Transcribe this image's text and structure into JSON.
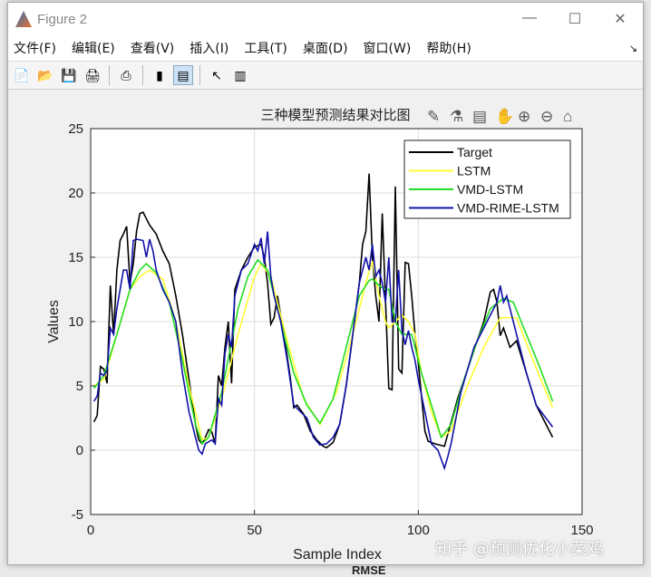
{
  "window": {
    "title": "Figure 2",
    "minimize": "—",
    "maximize": "☐",
    "close": "✕"
  },
  "menu": [
    "文件(F)",
    "编辑(E)",
    "查看(V)",
    "插入(I)",
    "工具(T)",
    "桌面(D)",
    "窗口(W)",
    "帮助(H)"
  ],
  "menu_arrow": "↘",
  "toolbar": [
    "📄",
    "📂",
    "💾",
    "🖨",
    "⎙",
    "▮",
    "▤",
    "↖",
    "▥"
  ],
  "axes_toolbar": [
    "✎",
    "⚗",
    "▤",
    "✋",
    "⊕",
    "⊖",
    "⌂"
  ],
  "watermark": "知乎 @预测优化小菜鸡",
  "background_text": "RMSE",
  "chart_data": {
    "type": "line",
    "title": "三种模型预测结果对比图",
    "xlabel": "Sample Index",
    "ylabel": "Values",
    "xlim": [
      0,
      150
    ],
    "ylim": [
      -5,
      25
    ],
    "xticks": [
      0,
      50,
      100,
      150
    ],
    "yticks": [
      -5,
      0,
      5,
      10,
      15,
      20,
      25
    ],
    "grid": true,
    "legend_position": "top-right",
    "series": [
      {
        "name": "Target",
        "color": "#000000",
        "x": [
          1,
          2,
          3,
          4,
          5,
          6,
          7,
          8,
          9,
          10,
          11,
          12,
          13,
          14,
          15,
          16,
          18,
          20,
          22,
          24,
          26,
          28,
          30,
          32,
          33,
          34,
          35,
          36,
          37,
          38,
          39,
          40,
          41,
          42,
          43,
          44,
          46,
          48,
          50,
          52,
          53,
          54,
          55,
          56,
          57,
          59,
          61,
          62,
          63,
          65,
          67,
          69,
          71,
          72,
          74,
          76,
          78,
          80,
          82,
          83,
          84,
          85,
          86,
          87,
          88,
          89,
          91,
          92,
          93,
          94,
          95,
          96,
          97,
          98,
          99,
          100,
          102,
          103,
          105,
          108,
          112,
          116,
          120,
          122,
          123,
          124,
          125,
          126,
          128,
          130,
          133,
          136,
          141
        ],
        "y": [
          2.2,
          2.7,
          6.5,
          6.3,
          5.2,
          12.8,
          9,
          14,
          16.3,
          16.8,
          17.4,
          13,
          14.5,
          17,
          18.4,
          18.5,
          17.5,
          16.8,
          15.5,
          14.5,
          12,
          9,
          5.5,
          2,
          0.8,
          0.5,
          1,
          1.6,
          1.4,
          0.5,
          5.8,
          5,
          8,
          10,
          5.2,
          12.5,
          14,
          15,
          15.8,
          16,
          15,
          13,
          9.8,
          10.3,
          12,
          9,
          5.5,
          3.3,
          3.5,
          2.8,
          1.5,
          0.8,
          0.3,
          0.2,
          0.6,
          2,
          5,
          9,
          13,
          16,
          17,
          21.5,
          15,
          12,
          10,
          18.4,
          4.8,
          4.7,
          20.5,
          6.3,
          6,
          14.6,
          14.5,
          12,
          9,
          6.8,
          1.5,
          0.7,
          0.5,
          0.3,
          4,
          7,
          10,
          12.3,
          12.5,
          11.5,
          8.9,
          9.5,
          8,
          8.5,
          6,
          3.5,
          1
        ]
      },
      {
        "name": "LSTM",
        "color": "#ffff33",
        "x": [
          1,
          4,
          8,
          12,
          15,
          18,
          22,
          26,
          30,
          34,
          36,
          40,
          45,
          50,
          52,
          55,
          60,
          65,
          70,
          75,
          80,
          84,
          86,
          88,
          90,
          91,
          93,
          95,
          97,
          99,
          101,
          104,
          107,
          110,
          115,
          120,
          125,
          130,
          135,
          141
        ],
        "y": [
          5,
          5.5,
          9,
          12.5,
          13.5,
          14,
          13.3,
          10,
          5,
          0.8,
          1,
          4,
          9,
          13.5,
          14.5,
          13.5,
          8.5,
          4,
          2,
          4.5,
          9,
          13,
          14.7,
          12,
          10,
          9.5,
          10,
          10.5,
          10,
          9,
          6,
          3,
          1,
          1.5,
          5,
          8,
          10.3,
          10.3,
          7,
          3.3
        ]
      },
      {
        "name": "VMD-LSTM",
        "color": "#22dd22",
        "x": [
          1,
          4,
          8,
          12,
          15,
          17,
          20,
          24,
          28,
          32,
          34,
          36,
          40,
          45,
          48,
          51,
          54,
          58,
          62,
          66,
          70,
          74,
          78,
          82,
          85,
          86,
          88,
          90,
          91,
          93,
          95,
          98,
          101,
          104,
          107,
          110,
          114,
          118,
          122,
          126,
          129,
          133,
          137,
          141
        ],
        "y": [
          4.8,
          5.8,
          9,
          12.5,
          14,
          14.5,
          13.8,
          11.5,
          7,
          2,
          0.5,
          1,
          4.5,
          11,
          13.5,
          14.8,
          14,
          10,
          6,
          3.5,
          2.1,
          4,
          8,
          12,
          13.2,
          13.3,
          12.8,
          12.5,
          12.5,
          10,
          9,
          9,
          6,
          3.5,
          1,
          2,
          5.5,
          8.5,
          11,
          11.8,
          11.5,
          9,
          6.5,
          3.8
        ]
      },
      {
        "name": "VMD-RIME-LSTM",
        "color": "#1111aa",
        "x": [
          1,
          2,
          3,
          4,
          5,
          6,
          7,
          8,
          9,
          10,
          11,
          12,
          13,
          14,
          16,
          17,
          18,
          19,
          20,
          22,
          24,
          26,
          28,
          30,
          32,
          33,
          34,
          35,
          37,
          38,
          39,
          40,
          41,
          42,
          43,
          44,
          46,
          48,
          50,
          51,
          52,
          53,
          54,
          55,
          56,
          58,
          60,
          62,
          64,
          66,
          68,
          70,
          72,
          74,
          76,
          78,
          80,
          82,
          84,
          85,
          86,
          87,
          88,
          89,
          90,
          91,
          92,
          93,
          94,
          95,
          96,
          97,
          98,
          99,
          100,
          102,
          104,
          106,
          108,
          109,
          110,
          113,
          117,
          121,
          124,
          125,
          126,
          127,
          128,
          130,
          133,
          136,
          141
        ],
        "y": [
          3.8,
          4.2,
          6,
          5.8,
          6.2,
          9.5,
          9,
          11,
          12.5,
          14,
          14,
          12.5,
          16.3,
          16.4,
          16.3,
          15,
          16.4,
          15.5,
          14,
          12.5,
          11.5,
          10,
          6,
          3,
          1,
          0,
          -0.3,
          0.5,
          0.8,
          0.5,
          4,
          3.5,
          7.5,
          9,
          8,
          12,
          14,
          14.5,
          16,
          15.5,
          16.5,
          14.5,
          17,
          13.5,
          12,
          10,
          7,
          3.5,
          3,
          2.5,
          1,
          0.4,
          0.5,
          1,
          2,
          5,
          9,
          13,
          15,
          14,
          16,
          13.5,
          14,
          13,
          11.5,
          15,
          10,
          10,
          14,
          9.3,
          8.2,
          9.3,
          8,
          7,
          5.5,
          3,
          0.5,
          0,
          -1.4,
          -0.5,
          0.5,
          4.5,
          8,
          10,
          11.5,
          12.8,
          11.5,
          12,
          11,
          9,
          6,
          3.5,
          1.8
        ]
      }
    ]
  }
}
